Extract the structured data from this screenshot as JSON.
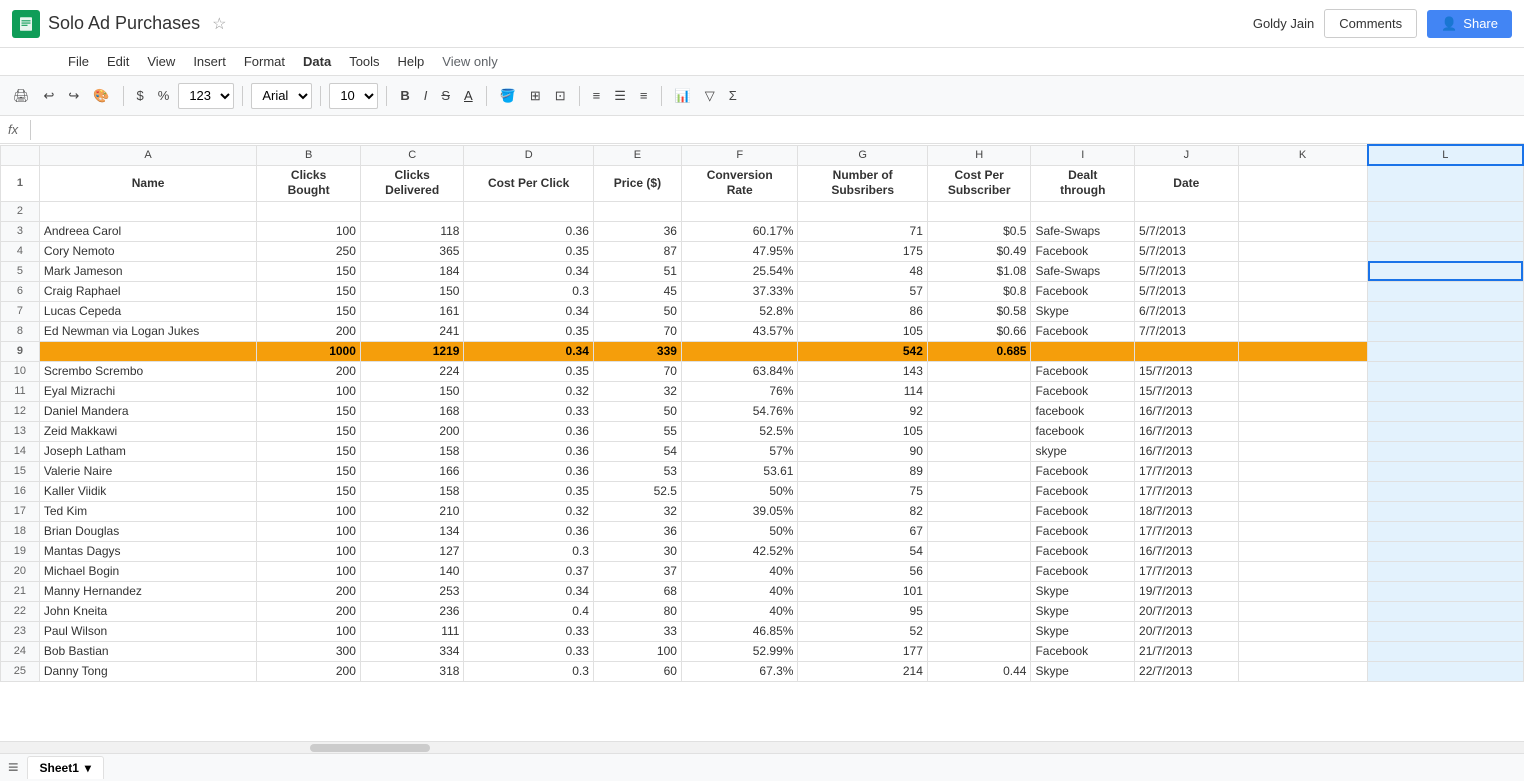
{
  "app": {
    "title": "Solo Ad Purchases",
    "icon": "sheets-icon",
    "user": "Goldy Jain",
    "view_only": "View only"
  },
  "buttons": {
    "comments": "Comments",
    "share": "Share"
  },
  "menu": {
    "items": [
      "File",
      "Edit",
      "View",
      "Insert",
      "Format",
      "Data",
      "Tools",
      "Help"
    ]
  },
  "toolbar": {
    "font": "Arial",
    "font_size": "10"
  },
  "formula_bar": {
    "cell_ref": "fx",
    "placeholder": ""
  },
  "columns": {
    "headers": [
      "",
      "A",
      "B",
      "C",
      "D",
      "E",
      "F",
      "G",
      "H",
      "I",
      "J",
      "K",
      "L"
    ],
    "col_a": "Name",
    "col_b_line1": "Clicks",
    "col_b_line2": "Bought",
    "col_c_line1": "Clicks",
    "col_c_line2": "Delivered",
    "col_d": "Cost Per Click",
    "col_e": "Price ($)",
    "col_f_line1": "Conversion",
    "col_f_line2": "Rate",
    "col_g_line1": "Number of",
    "col_g_line2": "Subsribers",
    "col_h_line1": "Cost Per",
    "col_h_line2": "Subscriber",
    "col_i_line1": "Dealt",
    "col_i_line2": "through",
    "col_j": "Date"
  },
  "rows": [
    {
      "num": 1,
      "type": "header"
    },
    {
      "num": 2,
      "type": "empty"
    },
    {
      "num": 3,
      "a": "Andreea Carol",
      "b": "100",
      "c": "118",
      "d": "0.36",
      "e": "36",
      "f": "60.17%",
      "g": "71",
      "h": "$0.5",
      "i": "Safe-Swaps",
      "j": "5/7/2013"
    },
    {
      "num": 4,
      "a": "Cory Nemoto",
      "b": "250",
      "c": "365",
      "d": "0.35",
      "e": "87",
      "f": "47.95%",
      "g": "175",
      "h": "$0.49",
      "i": "Facebook",
      "j": "5/7/2013"
    },
    {
      "num": 5,
      "a": "Mark Jameson",
      "b": "150",
      "c": "184",
      "d": "0.34",
      "e": "51",
      "f": "25.54%",
      "g": "48",
      "h": "$1.08",
      "i": "Safe-Swaps",
      "j": "5/7/2013"
    },
    {
      "num": 6,
      "a": "Craig Raphael",
      "b": "150",
      "c": "150",
      "d": "0.3",
      "e": "45",
      "f": "37.33%",
      "g": "57",
      "h": "$0.8",
      "i": "Facebook",
      "j": "5/7/2013"
    },
    {
      "num": 7,
      "a": "Lucas Cepeda",
      "b": "150",
      "c": "161",
      "d": "0.34",
      "e": "50",
      "f": "52.8%",
      "g": "86",
      "h": "$0.58",
      "i": "Skype",
      "j": "6/7/2013"
    },
    {
      "num": 8,
      "a": "Ed Newman via Logan Jukes",
      "b": "200",
      "c": "241",
      "d": "0.35",
      "e": "70",
      "f": "43.57%",
      "g": "105",
      "h": "$0.66",
      "i": "Facebook",
      "j": "7/7/2013"
    },
    {
      "num": 9,
      "type": "totals",
      "a": "",
      "b": "1000",
      "c": "1219",
      "d": "0.34",
      "e": "339",
      "f": "",
      "g": "542",
      "h": "0.685",
      "i": "",
      "j": ""
    },
    {
      "num": 10,
      "a": "Scrembo Scrembo",
      "b": "200",
      "c": "224",
      "d": "0.35",
      "e": "70",
      "f": "63.84%",
      "g": "143",
      "h": "",
      "i": "Facebook",
      "j": "15/7/2013"
    },
    {
      "num": 11,
      "a": "Eyal Mizrachi",
      "b": "100",
      "c": "150",
      "d": "0.32",
      "e": "32",
      "f": "76%",
      "g": "114",
      "h": "",
      "i": "Facebook",
      "j": "15/7/2013"
    },
    {
      "num": 12,
      "a": "Daniel Mandera",
      "b": "150",
      "c": "168",
      "d": "0.33",
      "e": "50",
      "f": "54.76%",
      "g": "92",
      "h": "",
      "i": "facebook",
      "j": "16/7/2013"
    },
    {
      "num": 13,
      "a": "Zeid Makkawi",
      "b": "150",
      "c": "200",
      "d": "0.36",
      "e": "55",
      "f": "52.5%",
      "g": "105",
      "h": "",
      "i": "facebook",
      "j": "16/7/2013"
    },
    {
      "num": 14,
      "a": "Joseph Latham",
      "b": "150",
      "c": "158",
      "d": "0.36",
      "e": "54",
      "f": "57%",
      "g": "90",
      "h": "",
      "i": "skype",
      "j": "16/7/2013"
    },
    {
      "num": 15,
      "a": "Valerie Naire",
      "b": "150",
      "c": "166",
      "d": "0.36",
      "e": "53",
      "f": "53.61",
      "g": "89",
      "h": "",
      "i": "Facebook",
      "j": "17/7/2013"
    },
    {
      "num": 16,
      "a": "Kaller Viidik",
      "b": "150",
      "c": "158",
      "d": "0.35",
      "e": "52.5",
      "f": "50%",
      "g": "75",
      "h": "",
      "i": "Facebook",
      "j": "17/7/2013"
    },
    {
      "num": 17,
      "a": "Ted Kim",
      "b": "100",
      "c": "210",
      "d": "0.32",
      "e": "32",
      "f": "39.05%",
      "g": "82",
      "h": "",
      "i": "Facebook",
      "j": "18/7/2013"
    },
    {
      "num": 18,
      "a": "Brian Douglas",
      "b": "100",
      "c": "134",
      "d": "0.36",
      "e": "36",
      "f": "50%",
      "g": "67",
      "h": "",
      "i": "Facebook",
      "j": "17/7/2013"
    },
    {
      "num": 19,
      "a": "Mantas Dagys",
      "b": "100",
      "c": "127",
      "d": "0.3",
      "e": "30",
      "f": "42.52%",
      "g": "54",
      "h": "",
      "i": "Facebook",
      "j": "16/7/2013"
    },
    {
      "num": 20,
      "a": "Michael Bogin",
      "b": "100",
      "c": "140",
      "d": "0.37",
      "e": "37",
      "f": "40%",
      "g": "56",
      "h": "",
      "i": "Facebook",
      "j": "17/7/2013"
    },
    {
      "num": 21,
      "a": "Manny Hernandez",
      "b": "200",
      "c": "253",
      "d": "0.34",
      "e": "68",
      "f": "40%",
      "g": "101",
      "h": "",
      "i": "Skype",
      "j": "19/7/2013"
    },
    {
      "num": 22,
      "a": "John Kneita",
      "b": "200",
      "c": "236",
      "d": "0.4",
      "e": "80",
      "f": "40%",
      "g": "95",
      "h": "",
      "i": "Skype",
      "j": "20/7/2013"
    },
    {
      "num": 23,
      "a": "Paul Wilson",
      "b": "100",
      "c": "111",
      "d": "0.33",
      "e": "33",
      "f": "46.85%",
      "g": "52",
      "h": "",
      "i": "Skype",
      "j": "20/7/2013"
    },
    {
      "num": 24,
      "a": "Bob Bastian",
      "b": "300",
      "c": "334",
      "d": "0.33",
      "e": "100",
      "f": "52.99%",
      "g": "177",
      "h": "",
      "i": "Facebook",
      "j": "21/7/2013"
    },
    {
      "num": 25,
      "a": "Danny Tong",
      "b": "200",
      "c": "318",
      "d": "0.3",
      "e": "60",
      "f": "67.3%",
      "g": "214",
      "h": "0.44",
      "i": "Skype",
      "j": "22/7/2013"
    }
  ],
  "sheet_tabs": [
    {
      "label": "Sheet1",
      "active": true
    }
  ]
}
